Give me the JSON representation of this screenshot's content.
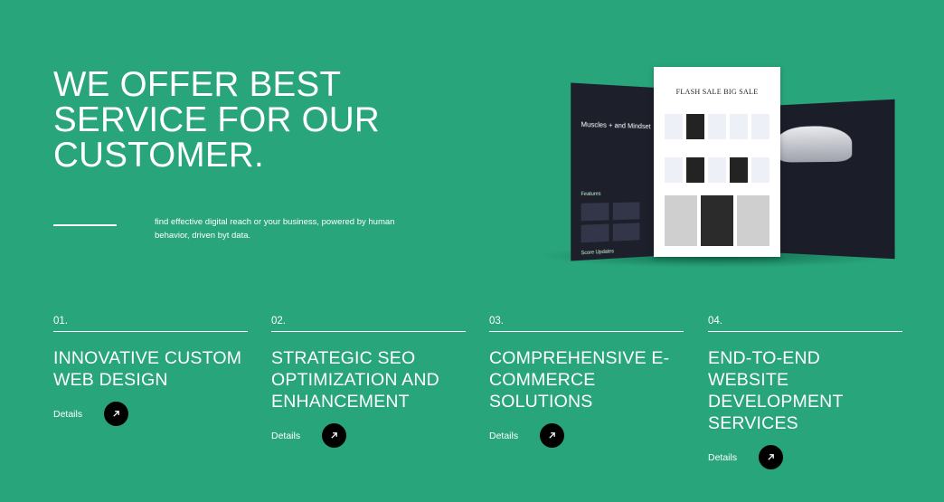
{
  "hero": {
    "title_lines": [
      "WE OFFER BEST",
      "SERVICE FOR OUR",
      "CUSTOMER."
    ],
    "tagline": "find effective digital reach or your business, powered by human behavior, driven byt data."
  },
  "mockup": {
    "left_screen_title": "Muscles + and Mindset",
    "left_features": "Features",
    "left_scores": "Score Updates",
    "page_title": "FLASH SALE BIG SALE"
  },
  "services": [
    {
      "number": "01.",
      "title": "INNOVATIVE CUSTOM WEB DESIGN",
      "details_label": "Details"
    },
    {
      "number": "02.",
      "title": "STRATEGIC SEO OPTIMIZATION AND ENHANCEMENT",
      "details_label": "Details"
    },
    {
      "number": "03.",
      "title": "COMPREHENSIVE E-COMMERCE SOLUTIONS",
      "details_label": "Details"
    },
    {
      "number": "04.",
      "title": "END-TO-END WEBSITE DEVELOPMENT SERVICES",
      "details_label": "Details"
    }
  ],
  "icons": {
    "details_arrow": "arrow-up-right-icon"
  },
  "colors": {
    "background": "#28a57b",
    "text": "#ffffff",
    "arrow_button": "#000000"
  }
}
